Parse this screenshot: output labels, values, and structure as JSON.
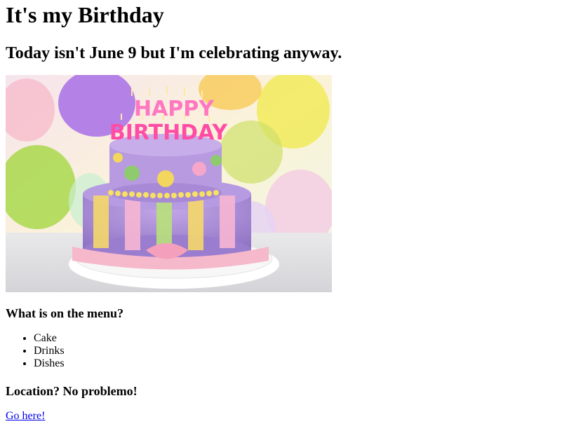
{
  "page": {
    "title": "It's my Birthday",
    "subtitle": "Today isn't June 9 but I'm celebrating anyway.",
    "image": {
      "candles_text_top": "HAPPY",
      "candles_text_bottom": "BIRTHDAY"
    },
    "menu_heading": "What is on the menu?",
    "menu_items": [
      "Cake",
      "Drinks",
      "Dishes"
    ],
    "location_heading": "Location? No problemo!",
    "link_text": "Go here!"
  },
  "colors": {
    "link": "#0000ee"
  }
}
